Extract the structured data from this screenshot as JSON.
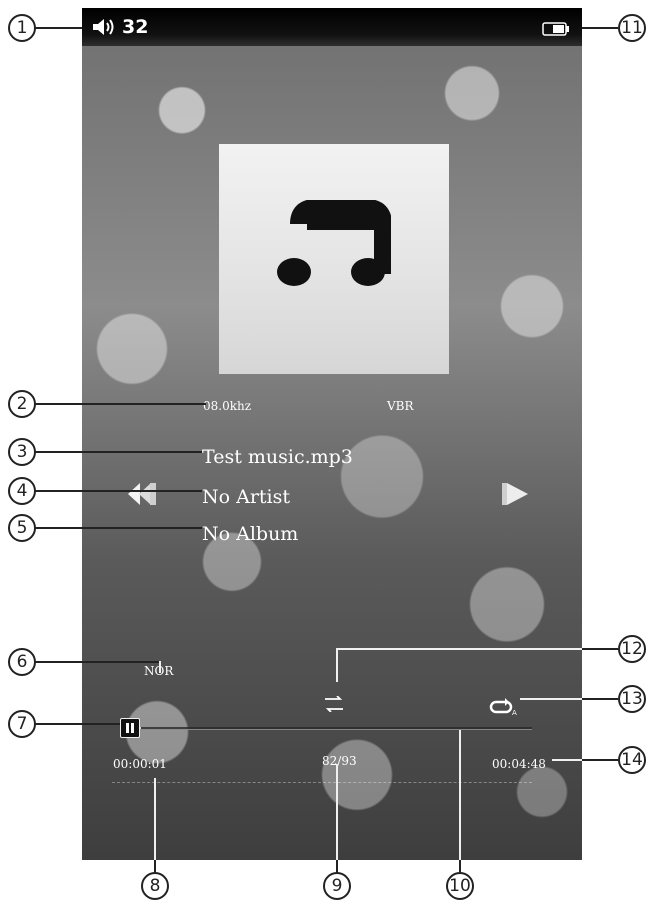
{
  "status_bar": {
    "volume_icon": "speaker-volume-icon",
    "volume_level": "32",
    "battery_icon": "battery-icon"
  },
  "album_art": {
    "icon": "music-note-icon"
  },
  "track_info": {
    "sample_rate": "08.0khz",
    "bitrate_mode": "VBR",
    "title": "Test music.mp3",
    "artist": "No Artist",
    "album": "No Album"
  },
  "controls": {
    "prev_icon": "rewind-previous-icon",
    "next_icon": "fast-forward-next-icon",
    "eq_mode": "NOR",
    "shuffle_icon": "shuffle-icon",
    "repeat_icon": "repeat-icon",
    "pause_icon": "pause-icon"
  },
  "playback": {
    "elapsed": "00:00:01",
    "track_position": "82/93",
    "total": "00:04:48",
    "progress_fraction": 0.003
  },
  "callouts": [
    "1",
    "2",
    "3",
    "4",
    "5",
    "6",
    "7",
    "8",
    "9",
    "10",
    "11",
    "12",
    "13",
    "14"
  ],
  "colors": {
    "text": "#ffffff",
    "statusbar": "#000000",
    "callout": "#222222"
  }
}
